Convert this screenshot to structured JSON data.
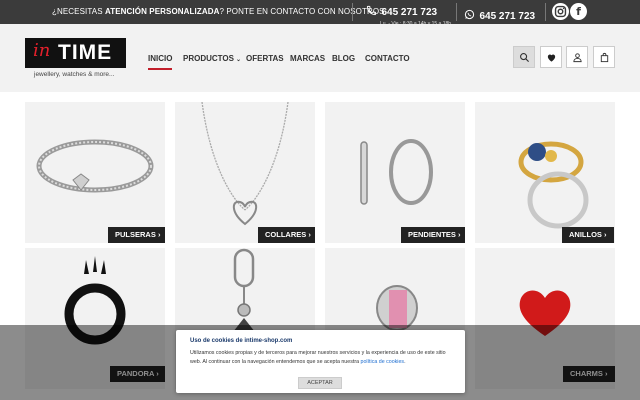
{
  "topbar": {
    "promo_prefix": "¿NECESITAS ",
    "promo_bold": "ATENCIÓN PERSONALIZADA",
    "promo_suffix": "? PONTE EN CONTACTO CON NOSOTROS",
    "phone": "645 271 723",
    "hours": "Lu. - Vie.: 8:30 a 14h y 15 a 18h.",
    "whatsapp": "645 271 723",
    "social": [
      "instagram-icon",
      "facebook-icon"
    ]
  },
  "header": {
    "logo_in": "in",
    "logo_time": "TIME",
    "tagline": "jewellery, watches & more...",
    "nav": [
      "INICIO",
      "PRODUCTOS",
      "OFERTAS",
      "MARCAS",
      "BLOG",
      "CONTACTO"
    ],
    "active_nav": "INICIO",
    "icons": [
      "search-icon",
      "heart-icon",
      "user-icon",
      "bag-icon"
    ]
  },
  "categories": [
    "PULSERAS",
    "COLLARES",
    "PENDIENTES",
    "ANILLOS",
    "PANDORA",
    "CHARMS"
  ],
  "cookie": {
    "title": "Uso de cookies de intime-shop.com",
    "text": "Utilizamos cookies propias y de terceros para mejorar nuestros servicios y la experiencia de uso de este sitio web. Al continuar con la navegación entendemos que se acepta nuestra ",
    "link": "política de cookies",
    "text_end": ".",
    "accept": "ACEPTAR"
  },
  "colors": {
    "topbar": "#3b3b3b",
    "accent": "#c21e2a",
    "label_bg": "#222222",
    "tile_bg": "#f2f2f2"
  }
}
